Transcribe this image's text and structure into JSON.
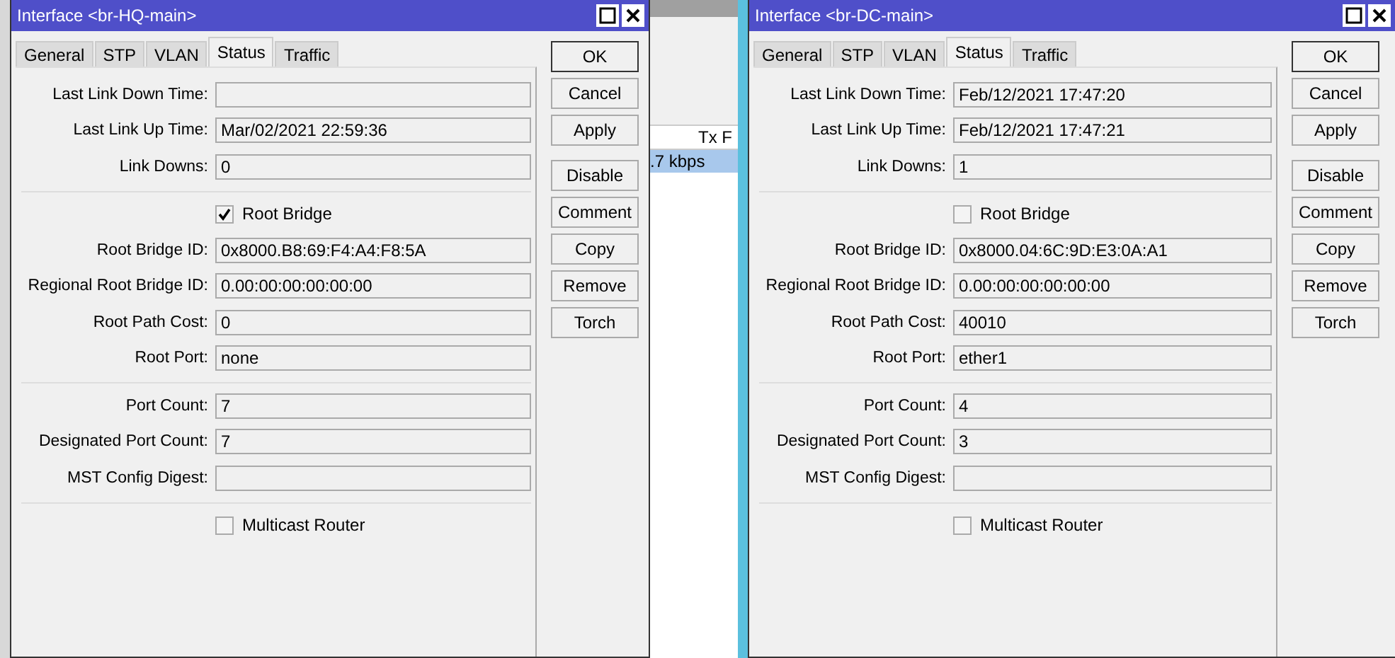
{
  "background": {
    "column_header": "Tx F",
    "cell": ".7 kbps"
  },
  "windows": [
    {
      "title": "Interface <br-HQ-main>",
      "tabs": [
        {
          "label": "General",
          "selected": false
        },
        {
          "label": "STP",
          "selected": false
        },
        {
          "label": "VLAN",
          "selected": false
        },
        {
          "label": "Status",
          "selected": true
        },
        {
          "label": "Traffic",
          "selected": false
        }
      ],
      "rows": [
        {
          "kind": "field",
          "label": "Last Link Down Time:",
          "value": ""
        },
        {
          "kind": "field",
          "label": "Last Link Up Time:",
          "value": "Mar/02/2021 22:59:36"
        },
        {
          "kind": "field",
          "label": "Link Downs:",
          "value": "0"
        },
        {
          "kind": "divider"
        },
        {
          "kind": "checkbox",
          "label": "Root Bridge",
          "checked": true
        },
        {
          "kind": "field",
          "label": "Root Bridge ID:",
          "value": "0x8000.B8:69:F4:A4:F8:5A"
        },
        {
          "kind": "field",
          "label": "Regional Root Bridge ID:",
          "value": "0.00:00:00:00:00:00"
        },
        {
          "kind": "field",
          "label": "Root Path Cost:",
          "value": "0"
        },
        {
          "kind": "field",
          "label": "Root Port:",
          "value": "none"
        },
        {
          "kind": "divider"
        },
        {
          "kind": "field",
          "label": "Port Count:",
          "value": "7"
        },
        {
          "kind": "field",
          "label": "Designated Port Count:",
          "value": "7"
        },
        {
          "kind": "field",
          "label": "MST Config Digest:",
          "value": ""
        },
        {
          "kind": "divider"
        },
        {
          "kind": "checkbox",
          "label": "Multicast Router",
          "checked": false
        }
      ],
      "buttons": [
        {
          "label": "OK",
          "default": true
        },
        {
          "label": "Cancel",
          "default": false
        },
        {
          "label": "Apply",
          "default": false
        },
        {
          "label": "Disable",
          "default": false
        },
        {
          "label": "Comment",
          "default": false
        },
        {
          "label": "Copy",
          "default": false
        },
        {
          "label": "Remove",
          "default": false
        },
        {
          "label": "Torch",
          "default": false
        }
      ]
    },
    {
      "title": "Interface <br-DC-main>",
      "tabs": [
        {
          "label": "General",
          "selected": false
        },
        {
          "label": "STP",
          "selected": false
        },
        {
          "label": "VLAN",
          "selected": false
        },
        {
          "label": "Status",
          "selected": true
        },
        {
          "label": "Traffic",
          "selected": false
        }
      ],
      "rows": [
        {
          "kind": "field",
          "label": "Last Link Down Time:",
          "value": "Feb/12/2021 17:47:20"
        },
        {
          "kind": "field",
          "label": "Last Link Up Time:",
          "value": "Feb/12/2021 17:47:21"
        },
        {
          "kind": "field",
          "label": "Link Downs:",
          "value": "1"
        },
        {
          "kind": "divider"
        },
        {
          "kind": "checkbox",
          "label": "Root Bridge",
          "checked": false
        },
        {
          "kind": "field",
          "label": "Root Bridge ID:",
          "value": "0x8000.04:6C:9D:E3:0A:A1"
        },
        {
          "kind": "field",
          "label": "Regional Root Bridge ID:",
          "value": "0.00:00:00:00:00:00"
        },
        {
          "kind": "field",
          "label": "Root Path Cost:",
          "value": "40010"
        },
        {
          "kind": "field",
          "label": "Root Port:",
          "value": "ether1"
        },
        {
          "kind": "divider"
        },
        {
          "kind": "field",
          "label": "Port Count:",
          "value": "4"
        },
        {
          "kind": "field",
          "label": "Designated Port Count:",
          "value": "3"
        },
        {
          "kind": "field",
          "label": "MST Config Digest:",
          "value": ""
        },
        {
          "kind": "divider"
        },
        {
          "kind": "checkbox",
          "label": "Multicast Router",
          "checked": false
        }
      ],
      "buttons": [
        {
          "label": "OK",
          "default": true
        },
        {
          "label": "Cancel",
          "default": false
        },
        {
          "label": "Apply",
          "default": false
        },
        {
          "label": "Disable",
          "default": false
        },
        {
          "label": "Comment",
          "default": false
        },
        {
          "label": "Copy",
          "default": false
        },
        {
          "label": "Remove",
          "default": false
        },
        {
          "label": "Torch",
          "default": false
        }
      ]
    }
  ]
}
